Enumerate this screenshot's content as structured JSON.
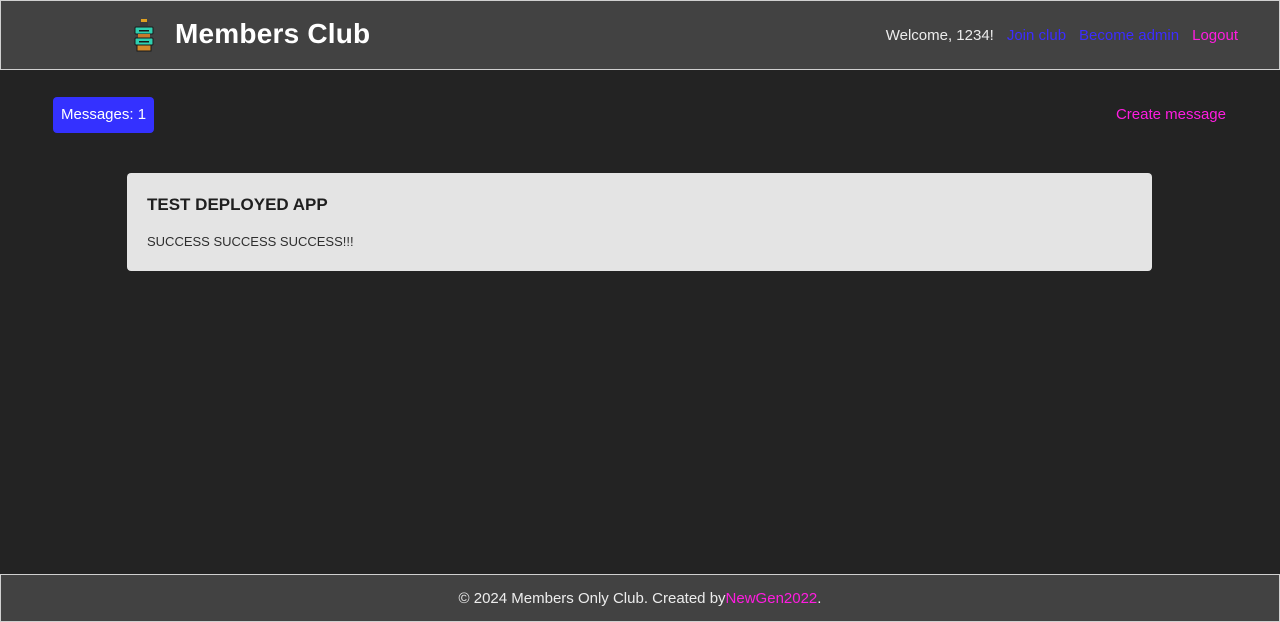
{
  "header": {
    "brand": "Members Club",
    "welcome": "Welcome, 1234!",
    "nav": {
      "join_club": "Join club",
      "become_admin": "Become admin",
      "logout": "Logout"
    }
  },
  "toolbar": {
    "messages_count": "Messages: 1",
    "create_message": "Create message"
  },
  "messages": [
    {
      "title": "TEST DEPLOYED APP",
      "body": "SUCCESS SUCCESS SUCCESS!!!"
    }
  ],
  "footer": {
    "text": "© 2024 Members Only Club. Created by ",
    "author": "NewGen2022",
    "suffix": "."
  },
  "colors": {
    "background": "#232323",
    "header_bg": "#424242",
    "accent_blue": "#3431ff",
    "link_blue": "#3c2cff",
    "link_pink": "#ff1ce0",
    "card_bg": "#e4e4e4"
  },
  "icons": {
    "logo": "members-club-logo-icon"
  }
}
